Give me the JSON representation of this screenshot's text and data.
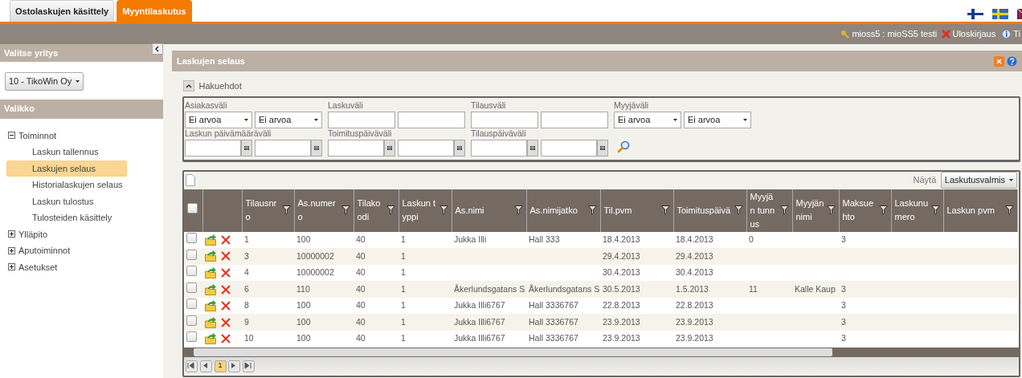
{
  "tabs": [
    {
      "label": "Ostolaskujen käsittely",
      "selected": false
    },
    {
      "label": "Myyntilaskutus",
      "selected": true
    }
  ],
  "user_bar": {
    "user": "mioss5 : mioSS5 testi",
    "logout": "Uloskirjaus",
    "info": "Ti"
  },
  "sidebar": {
    "company_title": "Valitse yritys",
    "company": "10 - TikoWin Oy",
    "menu_title": "Valikko",
    "menu": [
      {
        "label": "Toiminnot",
        "expanded": true,
        "children": [
          {
            "label": "Laskun tallennus",
            "selected": false
          },
          {
            "label": "Laskujen selaus",
            "selected": true
          },
          {
            "label": "Historialaskujen selaus",
            "selected": false
          },
          {
            "label": "Laskun tulostus",
            "selected": false
          },
          {
            "label": "Tulosteiden käsittely",
            "selected": false
          }
        ]
      },
      {
        "label": "Ylläpito",
        "expanded": false
      },
      {
        "label": "Aputoiminnot",
        "expanded": false
      },
      {
        "label": "Asetukset",
        "expanded": false
      }
    ]
  },
  "panel": {
    "title": "Laskujen selaus",
    "search_toggle": "Hakuehdot",
    "search_expanded": true,
    "filters": [
      {
        "label": "Asiakasväli",
        "kind": "select",
        "values": [
          "Ei arvoa",
          "Ei arvoa"
        ]
      },
      {
        "label": "Laskuväli",
        "kind": "text"
      },
      {
        "label": "Tilausväli",
        "kind": "text"
      },
      {
        "label": "Myyjäväli",
        "kind": "select",
        "values": [
          "Ei arvoa",
          "Ei arvoa"
        ]
      },
      {
        "label": "Laskun päivämääräväli",
        "kind": "date"
      },
      {
        "label": "Toimituspäiväväli",
        "kind": "date"
      },
      {
        "label": "Tilauspäiväväli",
        "kind": "date"
      }
    ]
  },
  "grid": {
    "show_label": "Näytä",
    "show_value": "Laskutusvalmis",
    "all_checked": false,
    "columns": [
      "Tilausnro",
      "As.numero",
      "Tilakoodi",
      "Laskun typpi",
      "As.nimi",
      "As.nimijatko",
      "Til.pvm",
      "Toimituspäivä",
      "Myyjän tunnus",
      "Myyjän nimi",
      "Maksuehto",
      "Laskunumero",
      "Laskun pvm"
    ],
    "rows": [
      {
        "checked": false,
        "cells": [
          "1",
          "100",
          "40",
          "1",
          "Jukka Illi",
          "Hall 333",
          "18.4.2013",
          "18.4.2013",
          "0",
          null,
          "3",
          null,
          null
        ]
      },
      {
        "checked": false,
        "cells": [
          "3",
          "10000002",
          "40",
          "1",
          null,
          null,
          "29.4.2013",
          "29.4.2013",
          null,
          null,
          null,
          null,
          null
        ]
      },
      {
        "checked": false,
        "cells": [
          "4",
          "10000002",
          "40",
          "1",
          null,
          null,
          "30.4.2013",
          "30.4.2013",
          null,
          null,
          null,
          null,
          null
        ]
      },
      {
        "checked": false,
        "cells": [
          "6",
          "110",
          "40",
          "1",
          "Åkerlundsgatans S",
          "Åkerlundsgatans S",
          "30.5.2013",
          "1.5.2013",
          "11",
          "Kalle Kaup",
          "3",
          null,
          null
        ]
      },
      {
        "checked": false,
        "cells": [
          "8",
          "100",
          "40",
          "1",
          "Jukka Illi6767",
          "Hall 3336767",
          "22.8.2013",
          "22.8.2013",
          null,
          null,
          "3",
          null,
          null
        ]
      },
      {
        "checked": false,
        "cells": [
          "9",
          "100",
          "40",
          "1",
          "Jukka Illi6767",
          "Hall 3336767",
          "23.9.2013",
          "23.9.2013",
          null,
          null,
          "3",
          null,
          null
        ]
      },
      {
        "checked": false,
        "cells": [
          "10",
          "100",
          "40",
          "1",
          "Jukka Illi6767",
          "Hall 3336767",
          "23.9.2013",
          "23.9.2013",
          null,
          null,
          "3",
          null,
          null
        ]
      }
    ],
    "pages": [
      {
        "label": "1",
        "selected": true
      }
    ]
  }
}
